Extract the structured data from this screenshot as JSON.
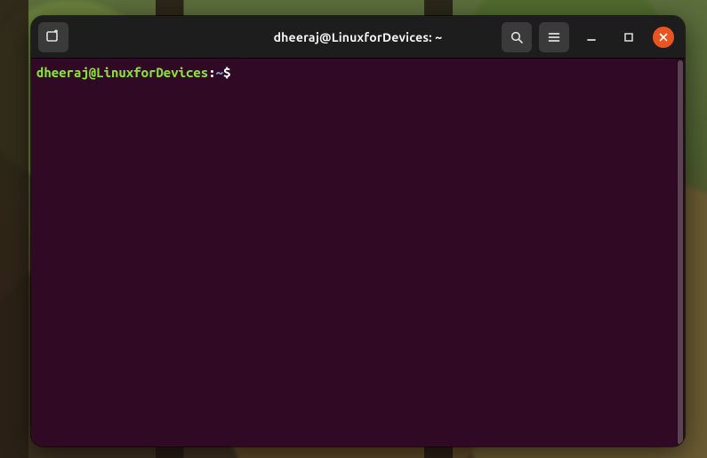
{
  "window": {
    "title": "dheeraj@LinuxforDevices: ~"
  },
  "prompt": {
    "user_host": "dheeraj@LinuxforDevices",
    "colon": ":",
    "path": "~",
    "symbol": "$"
  },
  "colors": {
    "terminal_bg": "#300a24",
    "titlebar_bg": "#1d1d1d",
    "close_btn": "#e95420",
    "prompt_user": "#8ae234",
    "prompt_path": "#729fcf"
  }
}
